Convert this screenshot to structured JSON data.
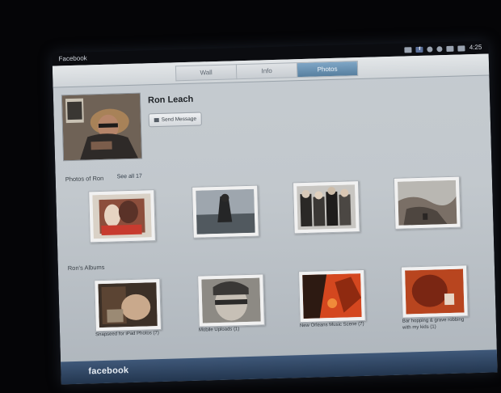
{
  "status_bar": {
    "app_name": "Facebook",
    "time": "4:25",
    "icons": [
      "mail-icon",
      "facebook-icon",
      "notification-icon",
      "signal-icon",
      "wifi-icon",
      "battery-icon"
    ]
  },
  "tabs": [
    {
      "label": "Wall",
      "active": false
    },
    {
      "label": "Info",
      "active": false
    },
    {
      "label": "Photos",
      "active": true
    }
  ],
  "profile": {
    "name": "Ron Leach",
    "send_message_label": "Send Message"
  },
  "photos_section": {
    "title": "Photos of Ron",
    "see_all": "See all 17"
  },
  "albums_section": {
    "title": "Ron's Albums",
    "albums": [
      {
        "name": "Snapseed for iPad Photos (7)"
      },
      {
        "name": "Mobile Uploads (1)"
      },
      {
        "name": "New Orleans Music Scene (7)"
      },
      {
        "name": "Bar hopping & grave robbing with my kids (1)"
      }
    ]
  },
  "footer": {
    "logo": "facebook"
  },
  "colors": {
    "active_tab": "#6c93b4",
    "footer_bar": "#2c4262",
    "page_background": "#c2c8cd"
  }
}
